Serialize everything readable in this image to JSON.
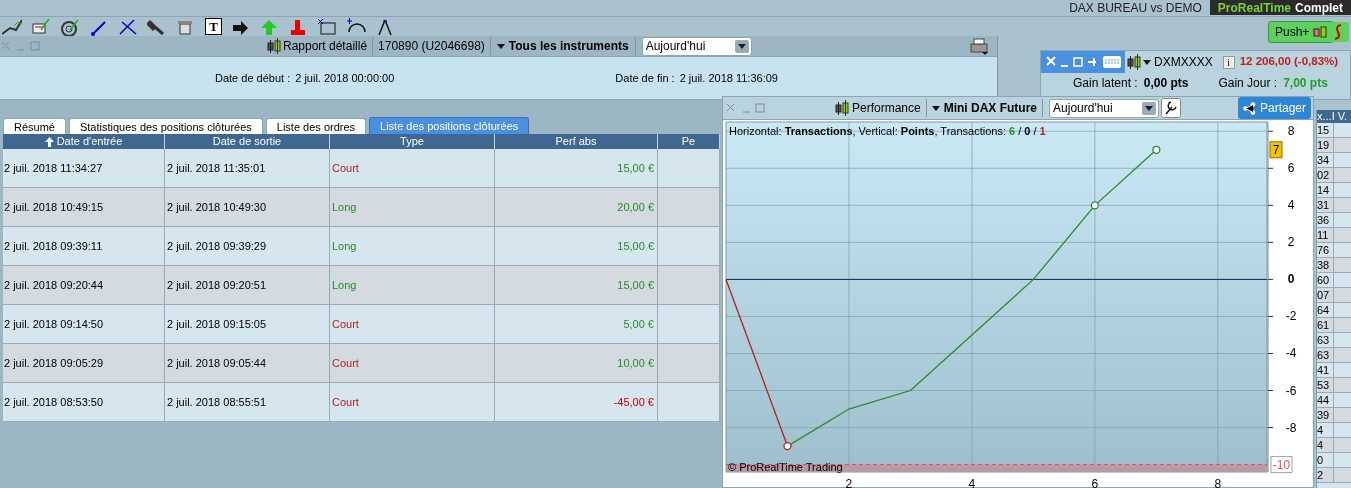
{
  "top_bar": {
    "workspace": "DAX BUREAU vs DEMO",
    "brand_part1": "ProRealTime",
    "brand_part2": "Complet"
  },
  "toolbar": {
    "text_tool": "T",
    "push_button": "Push+"
  },
  "report_window": {
    "title": "Rapport détaillé",
    "account": "170890 (U2046698)",
    "instrument": "Tous les instruments",
    "period": "Aujourd'hui",
    "start_label": "Date de début :",
    "start_value": "2 juil. 2018 00:00:00",
    "end_label": "Date de fin :",
    "end_value": "2 juil. 2018 11:36:09",
    "tabs": [
      {
        "label": "Résumé",
        "selected": false
      },
      {
        "label": "Statistiques des positions clôturées",
        "selected": false
      },
      {
        "label": "Liste des ordres",
        "selected": false
      },
      {
        "label": "Liste des positions clôturées",
        "selected": true
      }
    ],
    "columns": [
      "Date d'entrée",
      "Date de sortie",
      "Type",
      "Perf abs",
      "Pe"
    ],
    "rows": [
      {
        "entry": "2 juil. 2018 11:34:27",
        "exit": "2 juil. 2018 11:35:01",
        "type": "Court",
        "kind": "short",
        "perf": "15,00 €",
        "color": "#2a8a2a"
      },
      {
        "entry": "2 juil. 2018 10:49:15",
        "exit": "2 juil. 2018 10:49:30",
        "type": "Long",
        "kind": "long",
        "perf": "20,00 €",
        "color": "#2a8a2a"
      },
      {
        "entry": "2 juil. 2018 09:39:11",
        "exit": "2 juil. 2018 09:39:29",
        "type": "Long",
        "kind": "long",
        "perf": "15,00 €",
        "color": "#2a8a2a"
      },
      {
        "entry": "2 juil. 2018 09:20:44",
        "exit": "2 juil. 2018 09:20:51",
        "type": "Long",
        "kind": "long",
        "perf": "15,00 €",
        "color": "#2a8a2a"
      },
      {
        "entry": "2 juil. 2018 09:14:50",
        "exit": "2 juil. 2018 09:15:05",
        "type": "Court",
        "kind": "short",
        "perf": "5,00 €",
        "color": "#2a8a2a"
      },
      {
        "entry": "2 juil. 2018 09:05:29",
        "exit": "2 juil. 2018 09:05:44",
        "type": "Court",
        "kind": "short",
        "perf": "10,00 €",
        "color": "#2a8a2a"
      },
      {
        "entry": "2 juil. 2018 08:53:50",
        "exit": "2 juil. 2018 08:55:51",
        "type": "Court",
        "kind": "short",
        "perf": "-45,00 €",
        "color": "#d00000"
      }
    ]
  },
  "position_panel": {
    "ticker": "DXMXXXX",
    "info": "i",
    "price": "12 206,00 (-0,83%)",
    "latent_label": "Gain latent :",
    "latent_value": "0,00 pts",
    "day_label": "Gain Jour :",
    "day_value": "7,00 pts"
  },
  "performance_window": {
    "title": "Performance",
    "instrument": "Mini DAX Future",
    "period": "Aujourd'hui",
    "share_button": "Partager",
    "legend": {
      "text": "Horizontal: **Transactions**, Vertical: **Points**, Transactions: ",
      "wins": "6",
      "separator": "/",
      "neutral": "0",
      "losses": "1"
    },
    "copyright": "© ProRealTime Trading",
    "chart_data": {
      "type": "line",
      "grid": true,
      "xlim": [
        0,
        8.8
      ],
      "ylim": [
        -10.4,
        8.5
      ],
      "xticks": [
        2,
        4,
        6,
        8
      ],
      "yticks": [
        8,
        6,
        4,
        2,
        0,
        -2,
        -4,
        -6,
        -8
      ],
      "x": [
        0,
        1,
        2,
        3,
        4,
        5,
        6,
        7
      ],
      "series": [
        {
          "color": "#b22222",
          "values": [
            0,
            -9,
            null,
            null,
            null,
            null,
            null,
            null
          ]
        },
        {
          "color": "#2a8a2a",
          "values": [
            null,
            -9,
            -7,
            -6,
            -3,
            0,
            4,
            7
          ]
        }
      ],
      "ref_lines": [
        {
          "axis": "y",
          "value": -10,
          "label": "-10",
          "color": "#e05050"
        }
      ],
      "bands": [
        {
          "axis": "y",
          "from": -10.4,
          "to": -10,
          "color": "#b89aa4"
        }
      ],
      "annotations": [
        {
          "text": "7",
          "y": 7
        }
      ]
    }
  },
  "side_list": {
    "header": "x...I V.",
    "cells": [
      "15",
      "19",
      "34",
      "02",
      "14",
      "31",
      "36",
      "11",
      "76",
      "38",
      "60",
      "07",
      "64",
      "61",
      "63",
      "63",
      "41",
      "53",
      "44",
      "39",
      "4",
      "4",
      "0",
      "2"
    ]
  }
}
